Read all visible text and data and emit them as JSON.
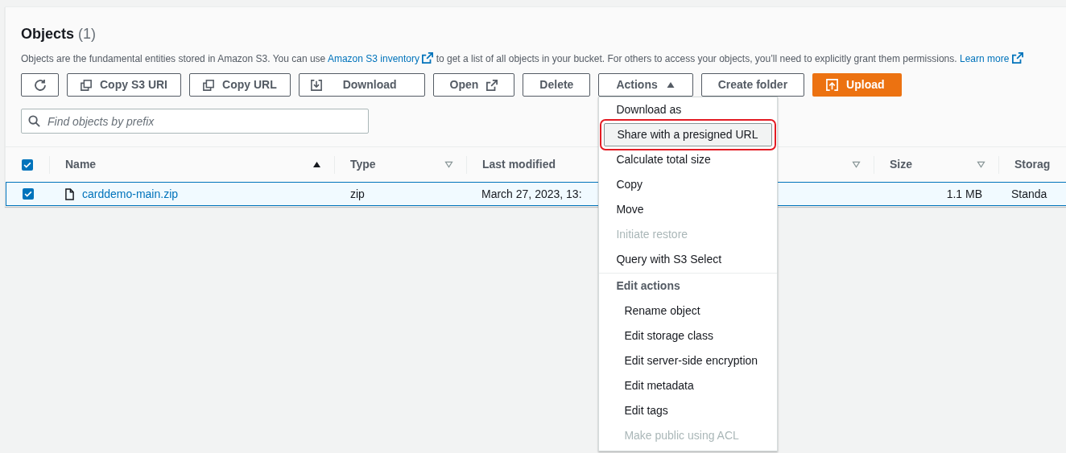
{
  "header": {
    "title": "Objects",
    "count": "(1)"
  },
  "description": [
    {
      "kind": "text",
      "text": "Objects are the fundamental entities stored in Amazon S3. You can use "
    },
    {
      "kind": "link",
      "text": "Amazon S3 inventory"
    },
    {
      "kind": "text",
      "text": " to get a list of all objects in your bucket. For others to access your objects, you’ll need to explicitly grant them permissions. "
    },
    {
      "kind": "link",
      "text": "Learn more"
    }
  ],
  "toolbar": [
    {
      "kind": "refresh"
    },
    {
      "kind": "copy",
      "label": "Copy S3 URI"
    },
    {
      "kind": "copy",
      "label": "Copy URL"
    },
    {
      "kind": "download",
      "label": "Download"
    },
    {
      "kind": "open",
      "label": "Open"
    },
    {
      "kind": "plain",
      "label": "Delete"
    },
    {
      "kind": "dropdown",
      "label": "Actions",
      "expanded": true
    },
    {
      "kind": "plain",
      "label": "Create folder"
    },
    {
      "kind": "primary",
      "label": "Upload"
    }
  ],
  "search": {
    "placeholder": "Find objects by prefix"
  },
  "actions_menu": [
    {
      "kind": "item",
      "label": "Download as",
      "disabled": false,
      "highlighted": false,
      "annotated": false
    },
    {
      "kind": "item",
      "label": "Share with a presigned URL",
      "disabled": false,
      "highlighted": true,
      "annotated": true
    },
    {
      "kind": "item",
      "label": "Calculate total size",
      "disabled": false,
      "highlighted": false,
      "annotated": false
    },
    {
      "kind": "item",
      "label": "Copy",
      "disabled": false,
      "highlighted": false,
      "annotated": false
    },
    {
      "kind": "item",
      "label": "Move",
      "disabled": false,
      "highlighted": false,
      "annotated": false
    },
    {
      "kind": "item",
      "label": "Initiate restore",
      "disabled": true,
      "highlighted": false,
      "annotated": false
    },
    {
      "kind": "item",
      "label": "Query with S3 Select",
      "disabled": false,
      "highlighted": false,
      "annotated": false
    },
    {
      "kind": "group",
      "label": "Edit actions",
      "children": [
        {
          "label": "Rename object",
          "disabled": false
        },
        {
          "label": "Edit storage class",
          "disabled": false
        },
        {
          "label": "Edit server-side encryption",
          "disabled": false
        },
        {
          "label": "Edit metadata",
          "disabled": false
        },
        {
          "label": "Edit tags",
          "disabled": false
        },
        {
          "label": "Make public using ACL",
          "disabled": true
        }
      ]
    }
  ],
  "table": {
    "all_checked": true,
    "columns": [
      {
        "label": "Name",
        "sorted": true
      },
      {
        "label": "Type",
        "sorted": false
      },
      {
        "label": "Last modified",
        "sorted": false
      },
      {
        "label": "Size",
        "sorted": false
      },
      {
        "label": "Storag"
      }
    ],
    "rows": [
      {
        "checked": true,
        "selected": true,
        "name": "carddemo-main.zip",
        "type": "zip",
        "last_modified": "March 27, 2023, 13:",
        "size": "1.1 MB",
        "storage": "Standa"
      }
    ]
  }
}
